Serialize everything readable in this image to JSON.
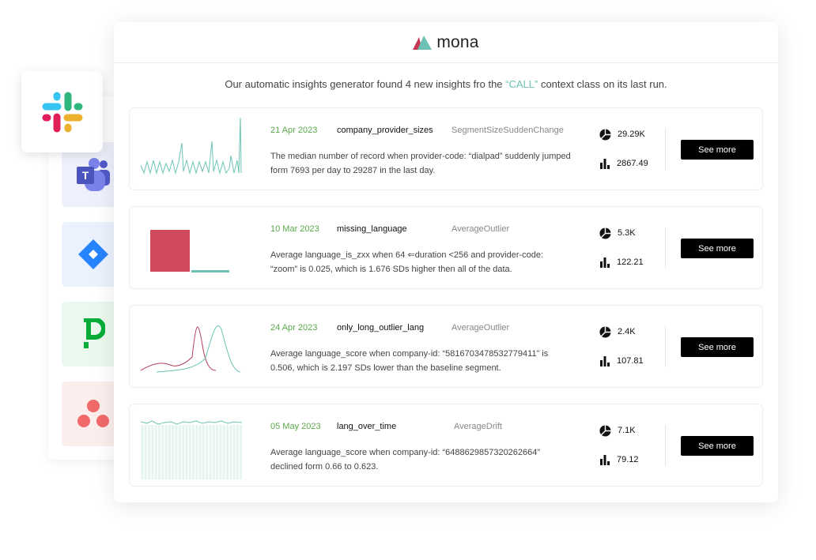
{
  "brand": {
    "name": "mona"
  },
  "intro": {
    "before": "Our automatic insights generator found 4 new insights fro the ",
    "highlight": "“CALL”",
    "after": " context class on its last run."
  },
  "integrations": [
    {
      "name": "Slack"
    },
    {
      "name": "Microsoft Teams",
      "letter": "T"
    },
    {
      "name": "Jira"
    },
    {
      "name": "PagerDuty"
    },
    {
      "name": "Asana"
    }
  ],
  "colors": {
    "accent": "#6cc3b5",
    "date": "#5aa84a",
    "button": "#000000",
    "outlier": "#d04a5e"
  },
  "insights": [
    {
      "date": "21 Apr 2023",
      "name": "company_provider_sizes",
      "type": "SegmentSizeSuddenChange",
      "desc": "The median number of record when provider-code: “dialpad” suddenly jumped form 7693 per day to 29287 in the last day.",
      "segment_size": "29.29K",
      "value": "2867.49",
      "button": "See more"
    },
    {
      "date": "10 Mar 2023",
      "name": "missing_language",
      "type": "AverageOutlier",
      "desc": "Average language_is_zxx when 64 ⇐duration <256 and provider-code: “zoom” is 0.025, which is 1.676 SDs higher then all of the data.",
      "segment_size": "5.3K",
      "value": "122.21",
      "button": "See more"
    },
    {
      "date": "24 Apr 2023",
      "name": "only_long_outlier_lang",
      "type": "AverageOutlier",
      "desc": "Average language_score when company-id: “5816703478532779411” is 0.506, which is 2.197 SDs lower than the baseline segment.",
      "segment_size": "2.4K",
      "value": "107.81",
      "button": "See more"
    },
    {
      "date": "05 May 2023",
      "name": "lang_over_time",
      "type": "AverageDrift",
      "desc": "Average language_score when company-id: “6488629857320262664” declined form 0.66 to 0.623.",
      "segment_size": "7.1K",
      "value": "79.12",
      "button": "See more"
    }
  ]
}
